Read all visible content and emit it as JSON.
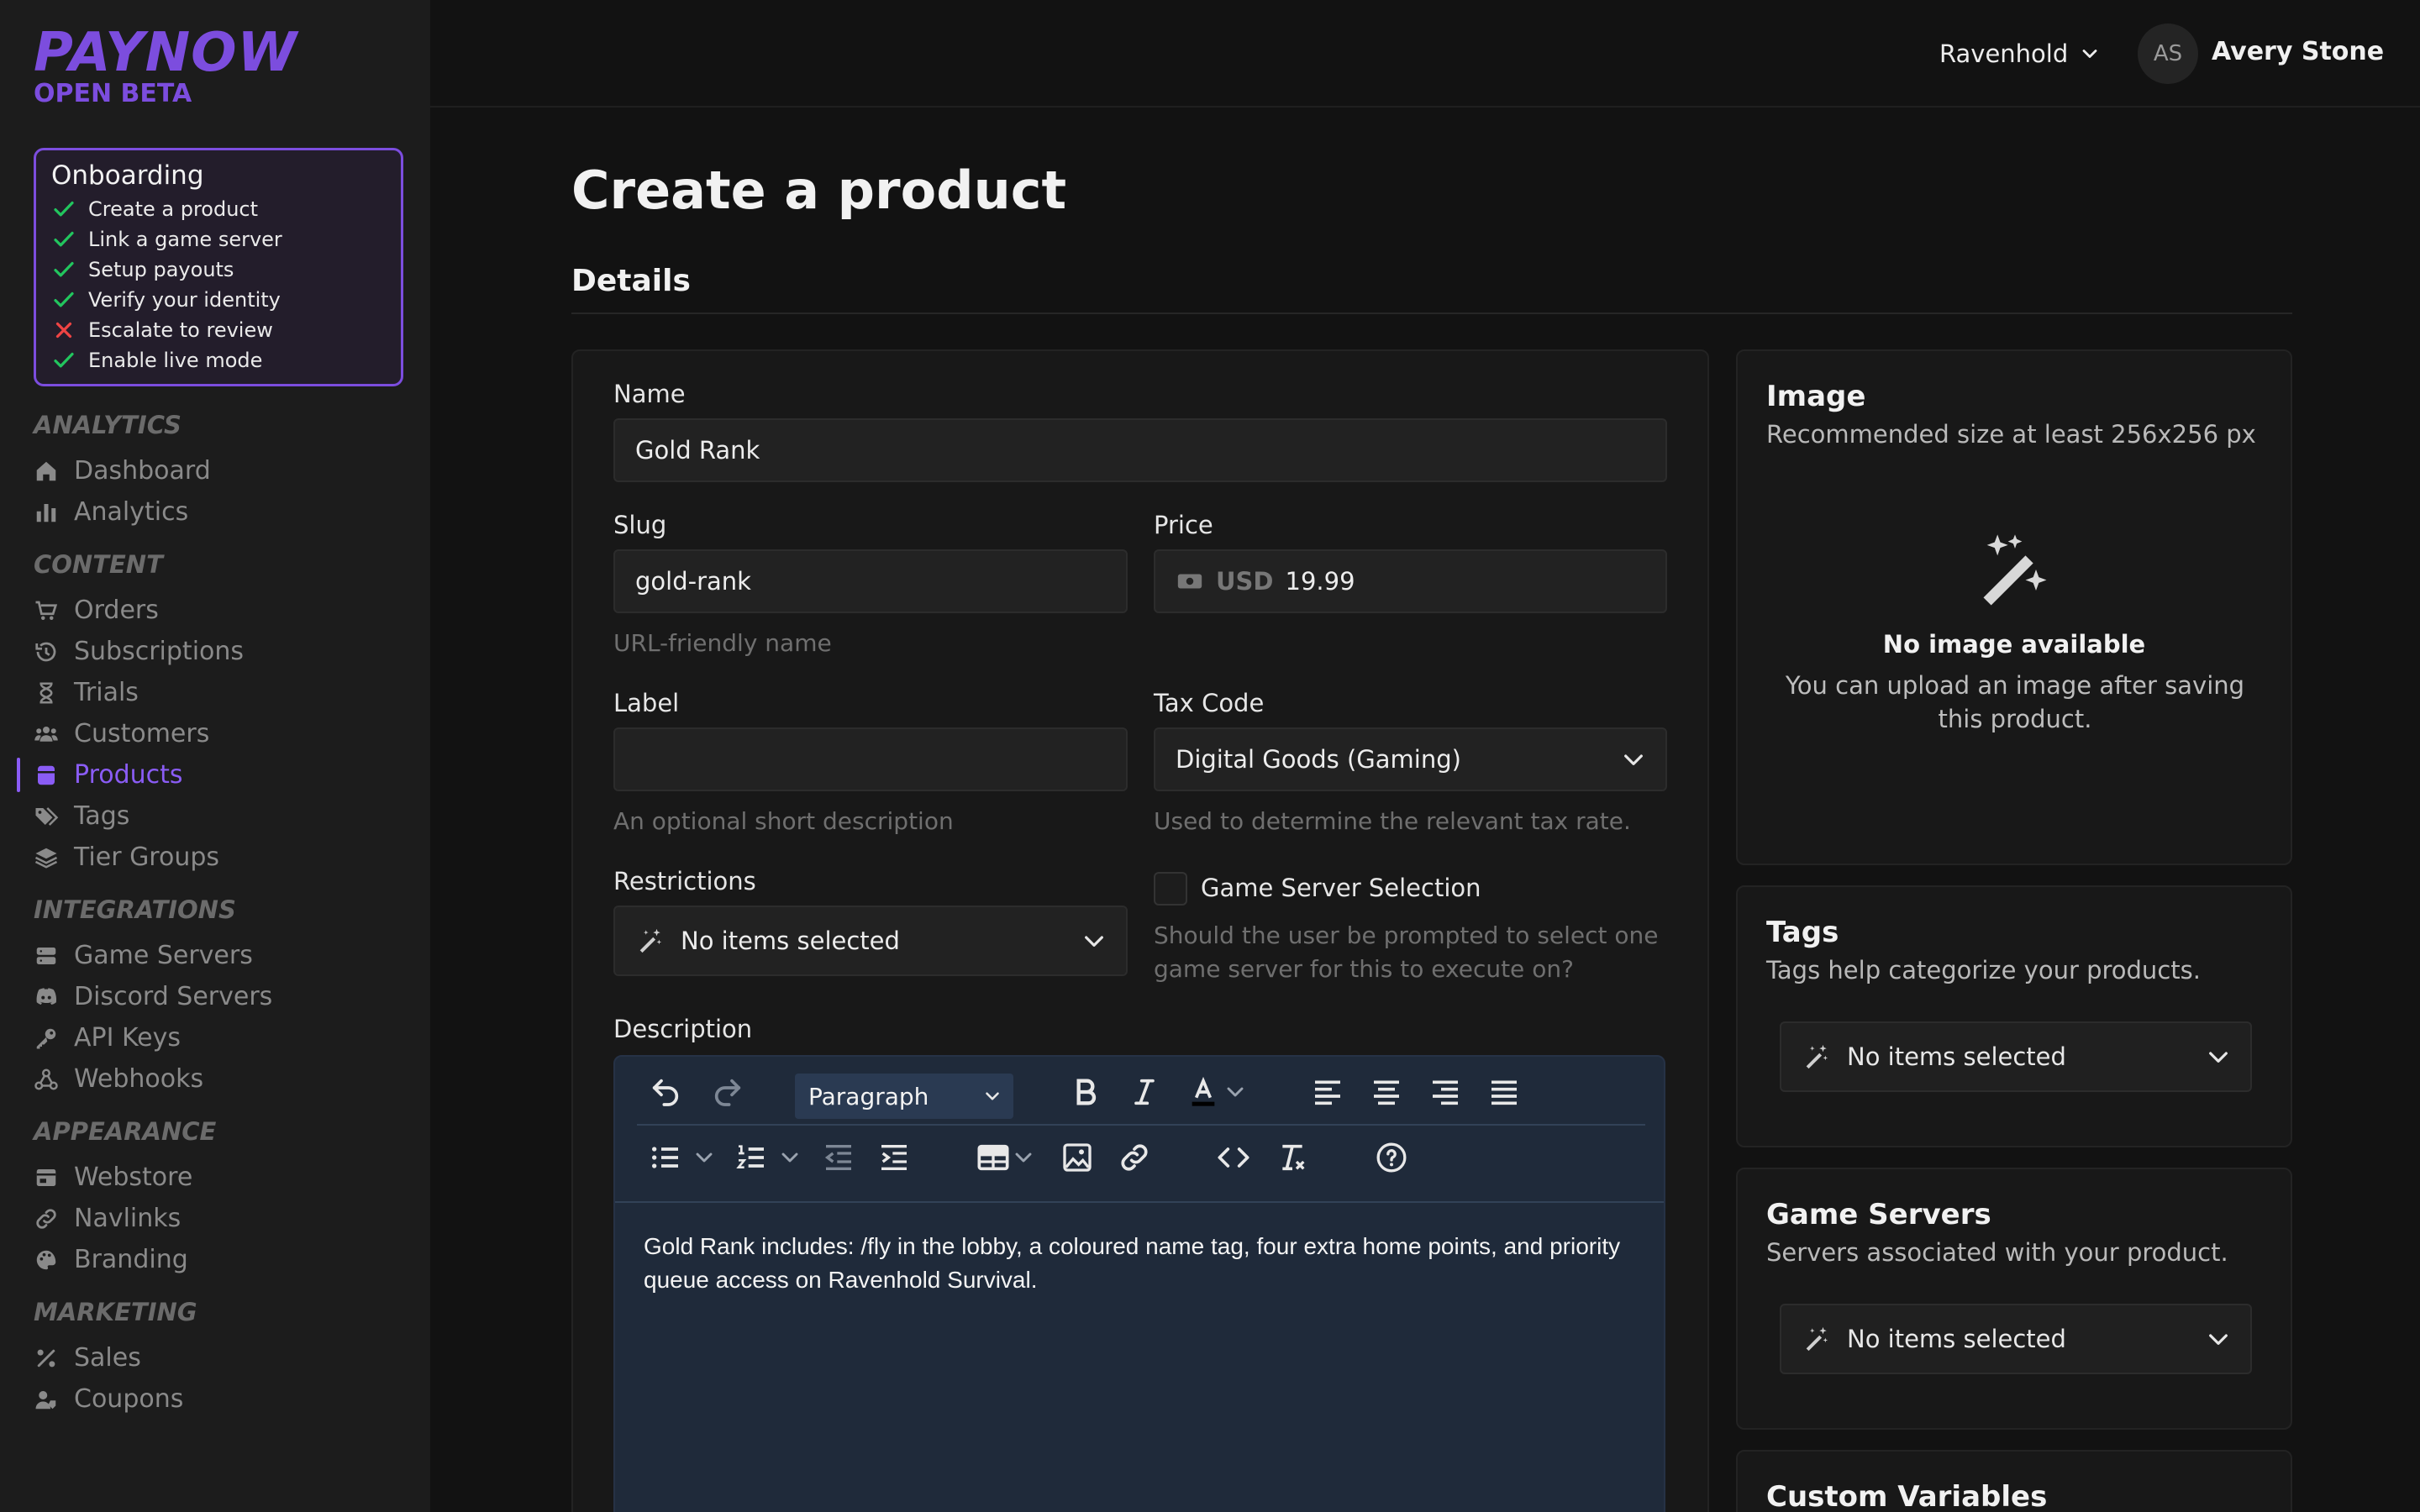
{
  "brand": {
    "name": "PAYNOW",
    "tag": "OPEN BETA",
    "accent": "#7c4dde"
  },
  "onboarding": {
    "title": "Onboarding",
    "items": [
      {
        "label": "Create a product",
        "done": true
      },
      {
        "label": "Link a game server",
        "done": true
      },
      {
        "label": "Setup payouts",
        "done": true
      },
      {
        "label": "Verify your identity",
        "done": true
      },
      {
        "label": "Escalate to review",
        "done": false
      },
      {
        "label": "Enable live mode",
        "done": true
      }
    ]
  },
  "nav": {
    "analytics": {
      "title": "ANALYTICS",
      "items": [
        "Dashboard",
        "Analytics"
      ]
    },
    "content": {
      "title": "CONTENT",
      "items": [
        "Orders",
        "Subscriptions",
        "Trials",
        "Customers",
        "Products",
        "Tags",
        "Tier Groups"
      ]
    },
    "integrations": {
      "title": "INTEGRATIONS",
      "items": [
        "Game Servers",
        "Discord Servers",
        "API Keys",
        "Webhooks"
      ]
    },
    "appearance": {
      "title": "APPEARANCE",
      "items": [
        "Webstore",
        "Navlinks",
        "Branding"
      ]
    },
    "marketing": {
      "title": "MARKETING",
      "items": [
        "Sales",
        "Coupons"
      ]
    },
    "active": "Products"
  },
  "topbar": {
    "workspace": "Ravenhold",
    "avatar_initials": "AS",
    "user_name": "Avery Stone"
  },
  "page": {
    "title": "Create a product",
    "section": "Details"
  },
  "form": {
    "name": {
      "label": "Name",
      "value": "Gold Rank"
    },
    "slug": {
      "label": "Slug",
      "value": "gold-rank",
      "hint": "URL-friendly name"
    },
    "price": {
      "label": "Price",
      "currency": "USD",
      "value": "19.99"
    },
    "label": {
      "label": "Label",
      "value": "",
      "hint": "An optional short description"
    },
    "tax_code": {
      "label": "Tax Code",
      "value": "Digital Goods (Gaming)",
      "hint": "Used to determine the relevant tax rate."
    },
    "restrictions": {
      "label": "Restrictions",
      "value": "No items selected"
    },
    "game_server_selection": {
      "label": "Game Server Selection",
      "checked": false,
      "hint": "Should the user be prompted to select one game server for this to execute on?"
    },
    "description": {
      "label": "Description",
      "block_format": "Paragraph",
      "text": "Gold Rank includes: /fly in the lobby, a coloured name tag, four extra home points, and priority queue access on Ravenhold Survival."
    }
  },
  "image_card": {
    "title": "Image",
    "subtitle": "Recommended size at least 256x256 px",
    "empty_title": "No image available",
    "empty_text": "You can upload an image after saving this product."
  },
  "tags_card": {
    "title": "Tags",
    "subtitle": "Tags help categorize your products.",
    "value": "No items selected"
  },
  "servers_card": {
    "title": "Game Servers",
    "subtitle": "Servers associated with your product.",
    "value": "No items selected"
  },
  "variables_card": {
    "title": "Custom Variables"
  }
}
